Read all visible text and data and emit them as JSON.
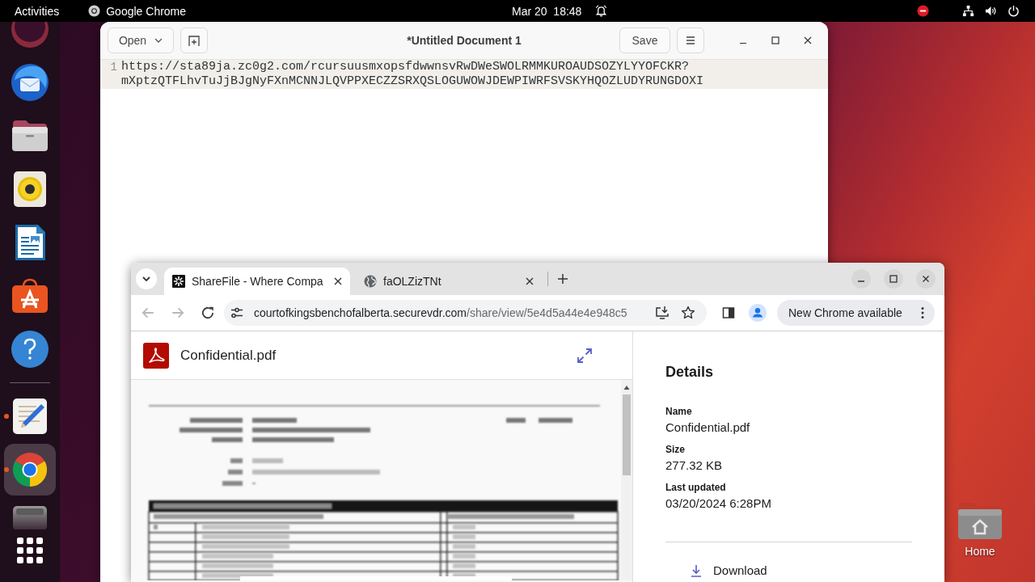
{
  "top_bar": {
    "activities": "Activities",
    "app_menu": "Google Chrome",
    "clock": "Mar 20  18:48"
  },
  "dock": {
    "pinned": [
      {
        "kind": "circle",
        "running": false,
        "selected": false
      },
      {
        "kind": "bird",
        "running": false,
        "selected": false
      },
      {
        "kind": "folder",
        "running": false,
        "selected": false
      },
      {
        "kind": "speaker",
        "running": false,
        "selected": false
      },
      {
        "kind": "document",
        "running": false,
        "selected": false
      },
      {
        "kind": "bag",
        "running": false,
        "selected": false
      },
      {
        "kind": "help",
        "running": false,
        "selected": false
      }
    ],
    "others": [
      {
        "kind": "notepad",
        "running": true,
        "selected": false
      },
      {
        "kind": "browser",
        "running": true,
        "selected": true
      },
      {
        "kind": "drive",
        "running": false,
        "selected": false
      }
    ]
  },
  "editor_window": {
    "open_button": "Open",
    "title": "*Untitled Document 1",
    "save_button": "Save",
    "lines": [
      {
        "number": "1",
        "current": true,
        "rows": [
          "https://sta89ja.zc0g2.com/rcursuusmxopsfdwwnsvRwDWeSWOLRMMKUROAUDSOZYLYYOFCKR?",
          "mXptzQTFLhvTuJjBJgNyFXnMCNNJLQVPPXECZZSRXQSLOGUWOWJDEWPIWRFSVSKYHQOZLUDYRUNGDOXI"
        ]
      }
    ]
  },
  "browser_window": {
    "tabs": [
      {
        "kind": "logo",
        "title": "ShareFile - Where Compa",
        "selected": true
      },
      {
        "kind": "globe",
        "title": "faOLZizTNt",
        "selected": false
      }
    ],
    "nav": [
      {
        "kind": "back",
        "disabled": true
      },
      {
        "kind": "forward",
        "disabled": true
      },
      {
        "kind": "reload",
        "disabled": false
      }
    ],
    "address": {
      "host": "courtofkingsbenchofalberta.securevdr.com",
      "path": "/share/view/5e4d5a44e4e948c5"
    },
    "update_button": "New Chrome available",
    "viewer": {
      "file_name": "Confidential.pdf"
    },
    "details": {
      "heading": "Details",
      "fields": [
        {
          "label": "Name",
          "value": "Confidential.pdf"
        },
        {
          "label": "Size",
          "value": "277.32 KB"
        },
        {
          "label": "Last updated",
          "value": "03/20/2024 6:28PM"
        }
      ],
      "download_button": "Download"
    }
  },
  "desktop": {
    "home_label": "Home"
  }
}
